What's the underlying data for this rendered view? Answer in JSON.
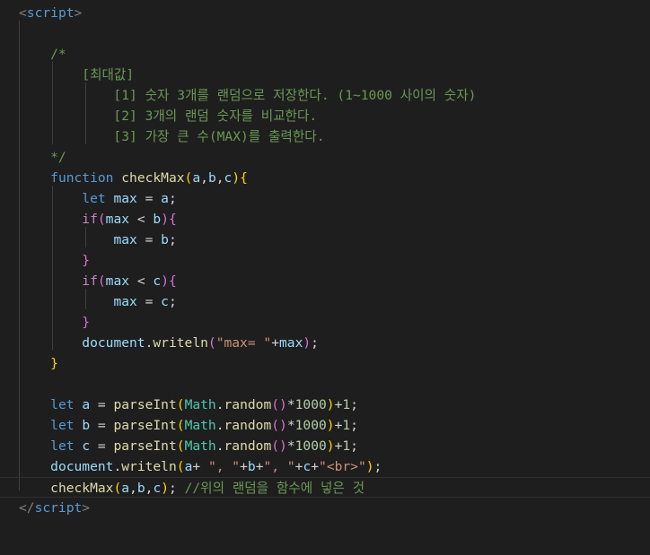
{
  "editor": {
    "language": "HTML / JavaScript",
    "lines": [
      [
        [
          "tag",
          "<"
        ],
        [
          "tagname",
          "script"
        ],
        [
          "tag",
          ">"
        ]
      ],
      [],
      [
        [
          "cm",
          "    /*"
        ]
      ],
      [
        [
          "cm",
          "        [최대값]"
        ]
      ],
      [
        [
          "cm",
          "            [1] 숫자 3개를 랜덤으로 저장한다. (1~1000 사이의 숫자)"
        ]
      ],
      [
        [
          "cm",
          "            [2] 3개의 랜덤 숫자를 비교한다."
        ]
      ],
      [
        [
          "cm",
          "            [3] 가장 큰 수(MAX)를 출력한다."
        ]
      ],
      [
        [
          "cm",
          "    */"
        ]
      ],
      [
        [
          "op",
          "    "
        ],
        [
          "kw",
          "function"
        ],
        [
          "op",
          " "
        ],
        [
          "fn",
          "checkMax"
        ],
        [
          "b1",
          "("
        ],
        [
          "prm",
          "a"
        ],
        [
          "op",
          ","
        ],
        [
          "prm",
          "b"
        ],
        [
          "op",
          ","
        ],
        [
          "prm",
          "c"
        ],
        [
          "b1",
          ")"
        ],
        [
          "b1",
          "{"
        ]
      ],
      [
        [
          "op",
          "        "
        ],
        [
          "kw",
          "let"
        ],
        [
          "op",
          " "
        ],
        [
          "var",
          "max"
        ],
        [
          "op",
          " = "
        ],
        [
          "var",
          "a"
        ],
        [
          "op",
          ";"
        ]
      ],
      [
        [
          "op",
          "        "
        ],
        [
          "kwc",
          "if"
        ],
        [
          "b2",
          "("
        ],
        [
          "var",
          "max"
        ],
        [
          "op",
          " < "
        ],
        [
          "var",
          "b"
        ],
        [
          "b2",
          ")"
        ],
        [
          "b2",
          "{"
        ]
      ],
      [
        [
          "op",
          "            "
        ],
        [
          "var",
          "max"
        ],
        [
          "op",
          " = "
        ],
        [
          "var",
          "b"
        ],
        [
          "op",
          ";"
        ]
      ],
      [
        [
          "op",
          "        "
        ],
        [
          "b2",
          "}"
        ]
      ],
      [
        [
          "op",
          "        "
        ],
        [
          "kwc",
          "if"
        ],
        [
          "b2",
          "("
        ],
        [
          "var",
          "max"
        ],
        [
          "op",
          " < "
        ],
        [
          "var",
          "c"
        ],
        [
          "b2",
          ")"
        ],
        [
          "b2",
          "{"
        ]
      ],
      [
        [
          "op",
          "            "
        ],
        [
          "var",
          "max"
        ],
        [
          "op",
          " = "
        ],
        [
          "var",
          "c"
        ],
        [
          "op",
          ";"
        ]
      ],
      [
        [
          "op",
          "        "
        ],
        [
          "b2",
          "}"
        ]
      ],
      [
        [
          "op",
          "        "
        ],
        [
          "var",
          "document"
        ],
        [
          "op",
          "."
        ],
        [
          "fn",
          "writeln"
        ],
        [
          "b2",
          "("
        ],
        [
          "str",
          "\"max= \""
        ],
        [
          "op",
          "+"
        ],
        [
          "var",
          "max"
        ],
        [
          "b2",
          ")"
        ],
        [
          "op",
          ";"
        ]
      ],
      [
        [
          "op",
          "    "
        ],
        [
          "b1",
          "}"
        ]
      ],
      [],
      [
        [
          "op",
          "    "
        ],
        [
          "kw",
          "let"
        ],
        [
          "op",
          " "
        ],
        [
          "var",
          "a"
        ],
        [
          "op",
          " = "
        ],
        [
          "fn",
          "parseInt"
        ],
        [
          "b1",
          "("
        ],
        [
          "cls",
          "Math"
        ],
        [
          "op",
          "."
        ],
        [
          "fn",
          "random"
        ],
        [
          "b2",
          "("
        ],
        [
          "b2",
          ")"
        ],
        [
          "op",
          "*"
        ],
        [
          "num",
          "1000"
        ],
        [
          "b1",
          ")"
        ],
        [
          "op",
          "+"
        ],
        [
          "num",
          "1"
        ],
        [
          "op",
          ";"
        ]
      ],
      [
        [
          "op",
          "    "
        ],
        [
          "kw",
          "let"
        ],
        [
          "op",
          " "
        ],
        [
          "var",
          "b"
        ],
        [
          "op",
          " = "
        ],
        [
          "fn",
          "parseInt"
        ],
        [
          "b1",
          "("
        ],
        [
          "cls",
          "Math"
        ],
        [
          "op",
          "."
        ],
        [
          "fn",
          "random"
        ],
        [
          "b2",
          "("
        ],
        [
          "b2",
          ")"
        ],
        [
          "op",
          "*"
        ],
        [
          "num",
          "1000"
        ],
        [
          "b1",
          ")"
        ],
        [
          "op",
          "+"
        ],
        [
          "num",
          "1"
        ],
        [
          "op",
          ";"
        ]
      ],
      [
        [
          "op",
          "    "
        ],
        [
          "kw",
          "let"
        ],
        [
          "op",
          " "
        ],
        [
          "var",
          "c"
        ],
        [
          "op",
          " = "
        ],
        [
          "fn",
          "parseInt"
        ],
        [
          "b1",
          "("
        ],
        [
          "cls",
          "Math"
        ],
        [
          "op",
          "."
        ],
        [
          "fn",
          "random"
        ],
        [
          "b2",
          "("
        ],
        [
          "b2",
          ")"
        ],
        [
          "op",
          "*"
        ],
        [
          "num",
          "1000"
        ],
        [
          "b1",
          ")"
        ],
        [
          "op",
          "+"
        ],
        [
          "num",
          "1"
        ],
        [
          "op",
          ";"
        ]
      ],
      [
        [
          "op",
          "    "
        ],
        [
          "var",
          "document"
        ],
        [
          "op",
          "."
        ],
        [
          "fn",
          "writeln"
        ],
        [
          "b1",
          "("
        ],
        [
          "var",
          "a"
        ],
        [
          "op",
          "+ "
        ],
        [
          "str",
          "\", \""
        ],
        [
          "op",
          "+"
        ],
        [
          "var",
          "b"
        ],
        [
          "op",
          "+"
        ],
        [
          "str",
          "\", \""
        ],
        [
          "op",
          "+"
        ],
        [
          "var",
          "c"
        ],
        [
          "op",
          "+"
        ],
        [
          "str",
          "\"<br>\""
        ],
        [
          "b1",
          ")"
        ],
        [
          "op",
          ";"
        ]
      ],
      [
        [
          "op",
          "    "
        ],
        [
          "fn",
          "checkMax"
        ],
        [
          "b1",
          "("
        ],
        [
          "var",
          "a"
        ],
        [
          "op",
          ","
        ],
        [
          "var",
          "b"
        ],
        [
          "op",
          ","
        ],
        [
          "var",
          "c"
        ],
        [
          "b1",
          ")"
        ],
        [
          "op",
          "; "
        ],
        [
          "cm",
          "//위의 랜덤을 함수에 넣은 것"
        ]
      ],
      [
        [
          "tag",
          "</"
        ],
        [
          "tagname",
          "script"
        ],
        [
          "tag",
          ">"
        ]
      ]
    ]
  }
}
